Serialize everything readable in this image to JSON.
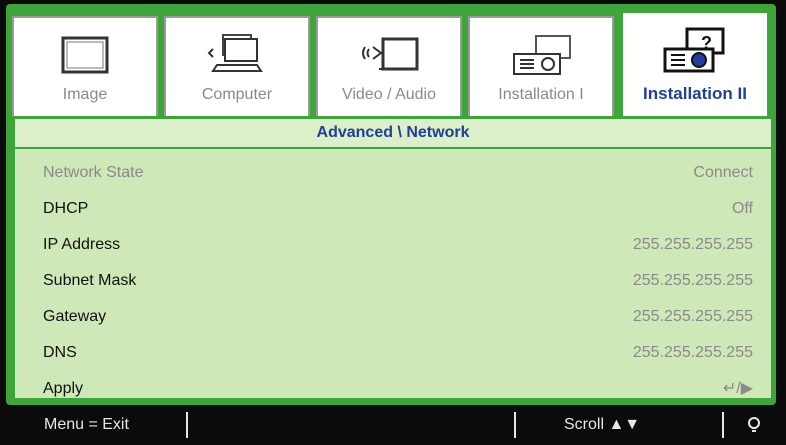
{
  "tabs": [
    {
      "label": "Image",
      "icon": "monitor-icon",
      "active": false
    },
    {
      "label": "Computer",
      "icon": "computer-icon",
      "active": false
    },
    {
      "label": "Video / Audio",
      "icon": "video-audio-icon",
      "active": false
    },
    {
      "label": "Installation I",
      "icon": "projector-icon",
      "active": false
    },
    {
      "label": "Installation II",
      "icon": "projector-help-icon",
      "active": true
    }
  ],
  "panel": {
    "title": "Advanced \\ Network",
    "rows": [
      {
        "label": "Network State",
        "value": "Connect"
      },
      {
        "label": "DHCP",
        "value": "Off"
      },
      {
        "label": "IP Address",
        "value": "255.255.255.255"
      },
      {
        "label": "Subnet Mask",
        "value": "255.255.255.255"
      },
      {
        "label": "Gateway",
        "value": "255.255.255.255"
      },
      {
        "label": "DNS",
        "value": "255.255.255.255"
      },
      {
        "label": "Apply",
        "value": "↵/▶"
      }
    ]
  },
  "status": {
    "menu_exit": "Menu = Exit",
    "scroll": "Scroll ▲▼",
    "power_icon": "bulb-icon"
  },
  "colors": {
    "accent_green": "#3da53a",
    "panel_bg": "#cfe8b8",
    "title_blue": "#1f3f9a"
  }
}
